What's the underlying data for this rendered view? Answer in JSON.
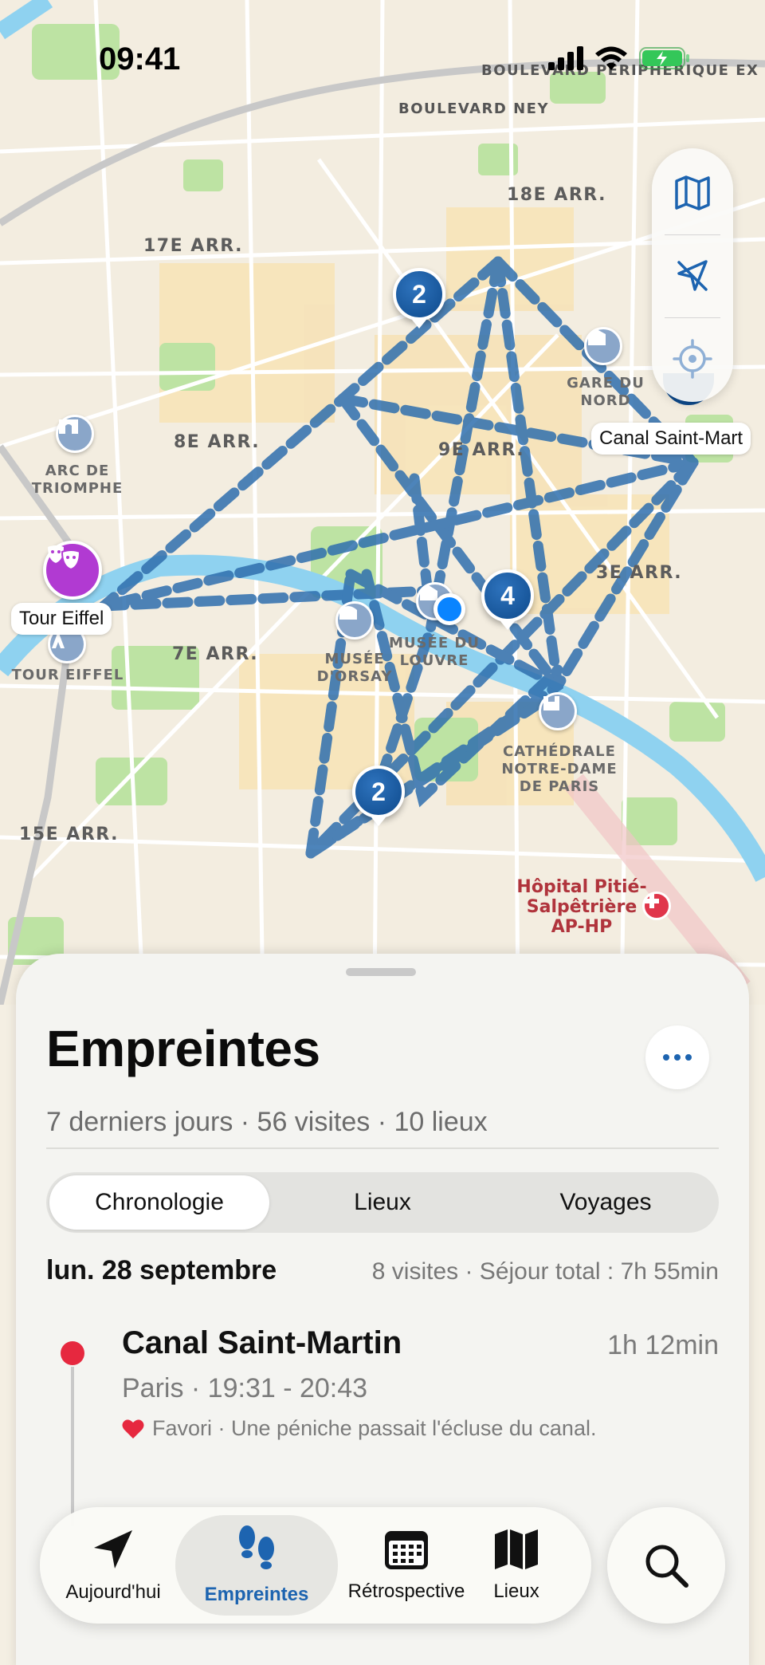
{
  "status_bar": {
    "time": "09:41"
  },
  "map": {
    "street_labels": [
      "BOULEVARD NEY",
      "BOULEVARD PÉRIPHÉRIQUE EX"
    ],
    "district_labels": [
      "18E ARR.",
      "17E ARR.",
      "8E ARR.",
      "9E ARR.",
      "3E ARR.",
      "7E ARR.",
      "15E ARR."
    ],
    "poi": {
      "arc": "ARC DE\nTRIOMPHE",
      "gare": "GARE DU NORD",
      "orsay": "MUSÉE\nD'ORSAY",
      "louvre": "MUSÉE DU\nLOUVRE",
      "notre_dame": "CATHÉDRALE\nNOTRE-DAME\nDE PARIS",
      "eiffel": "TOUR EIFFEL"
    },
    "hospital": "Hôpital Pitié-\nSalpêtrière\nAP-HP",
    "callouts": {
      "eiffel": "Tour Eiffel",
      "canal": "Canal Saint-Mart"
    },
    "clusters": [
      "2",
      "4",
      "2"
    ]
  },
  "sheet": {
    "title": "Empreintes",
    "subtitle": "7 derniers jours · 56 visites · 10 lieux",
    "segments": [
      "Chronologie",
      "Lieux",
      "Voyages"
    ],
    "active_segment": "Chronologie",
    "day": {
      "date": "lun. 28 septembre",
      "summary": "8 visites · Séjour total : 7h 55min"
    },
    "visit": {
      "title": "Canal Saint-Martin",
      "duration": "1h 12min",
      "place": "Paris · 19:31 - 20:43",
      "note": "Favori · Une péniche passait l'écluse du canal."
    }
  },
  "tab_bar": {
    "tabs": [
      "Aujourd'hui",
      "Empreintes",
      "Rétrospective",
      "Lieux"
    ],
    "active": "Empreintes"
  },
  "colors": {
    "route": "#2f6fae",
    "accent": "#1d64b0",
    "visit_dot": "#e6283f",
    "water": "#8fd2f0",
    "park": "#b9e0a0"
  }
}
